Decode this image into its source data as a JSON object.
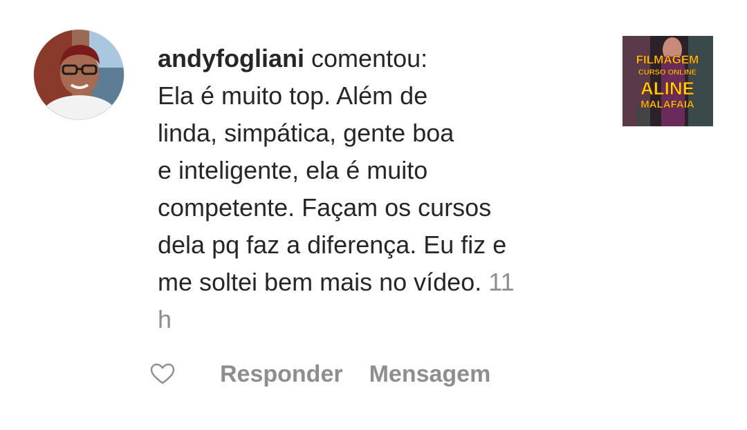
{
  "comment": {
    "username": "andyfogliani",
    "verb": "comentou:",
    "lines": [
      "Ela é muito top. Além de",
      "linda, simpática, gente boa",
      "e inteligente, ela é muito",
      "competente. Façam os cursos",
      "dela pq faz a diferença. Eu fiz e",
      "me soltei bem mais no vídeo."
    ],
    "timestamp_part1": "11",
    "timestamp_part2": "h"
  },
  "thumbnail": {
    "line1": "FILMAGEM",
    "line2": "CURSO ONLINE",
    "line3": "ALINE",
    "line4": "MALAFAIA"
  },
  "actions": {
    "like_icon": "heart-outline-icon",
    "reply_label": "Responder",
    "message_label": "Mensagem"
  },
  "colors": {
    "text": "#262626",
    "muted": "#8e8e8e",
    "thumb_yellow": "#f5d900"
  }
}
